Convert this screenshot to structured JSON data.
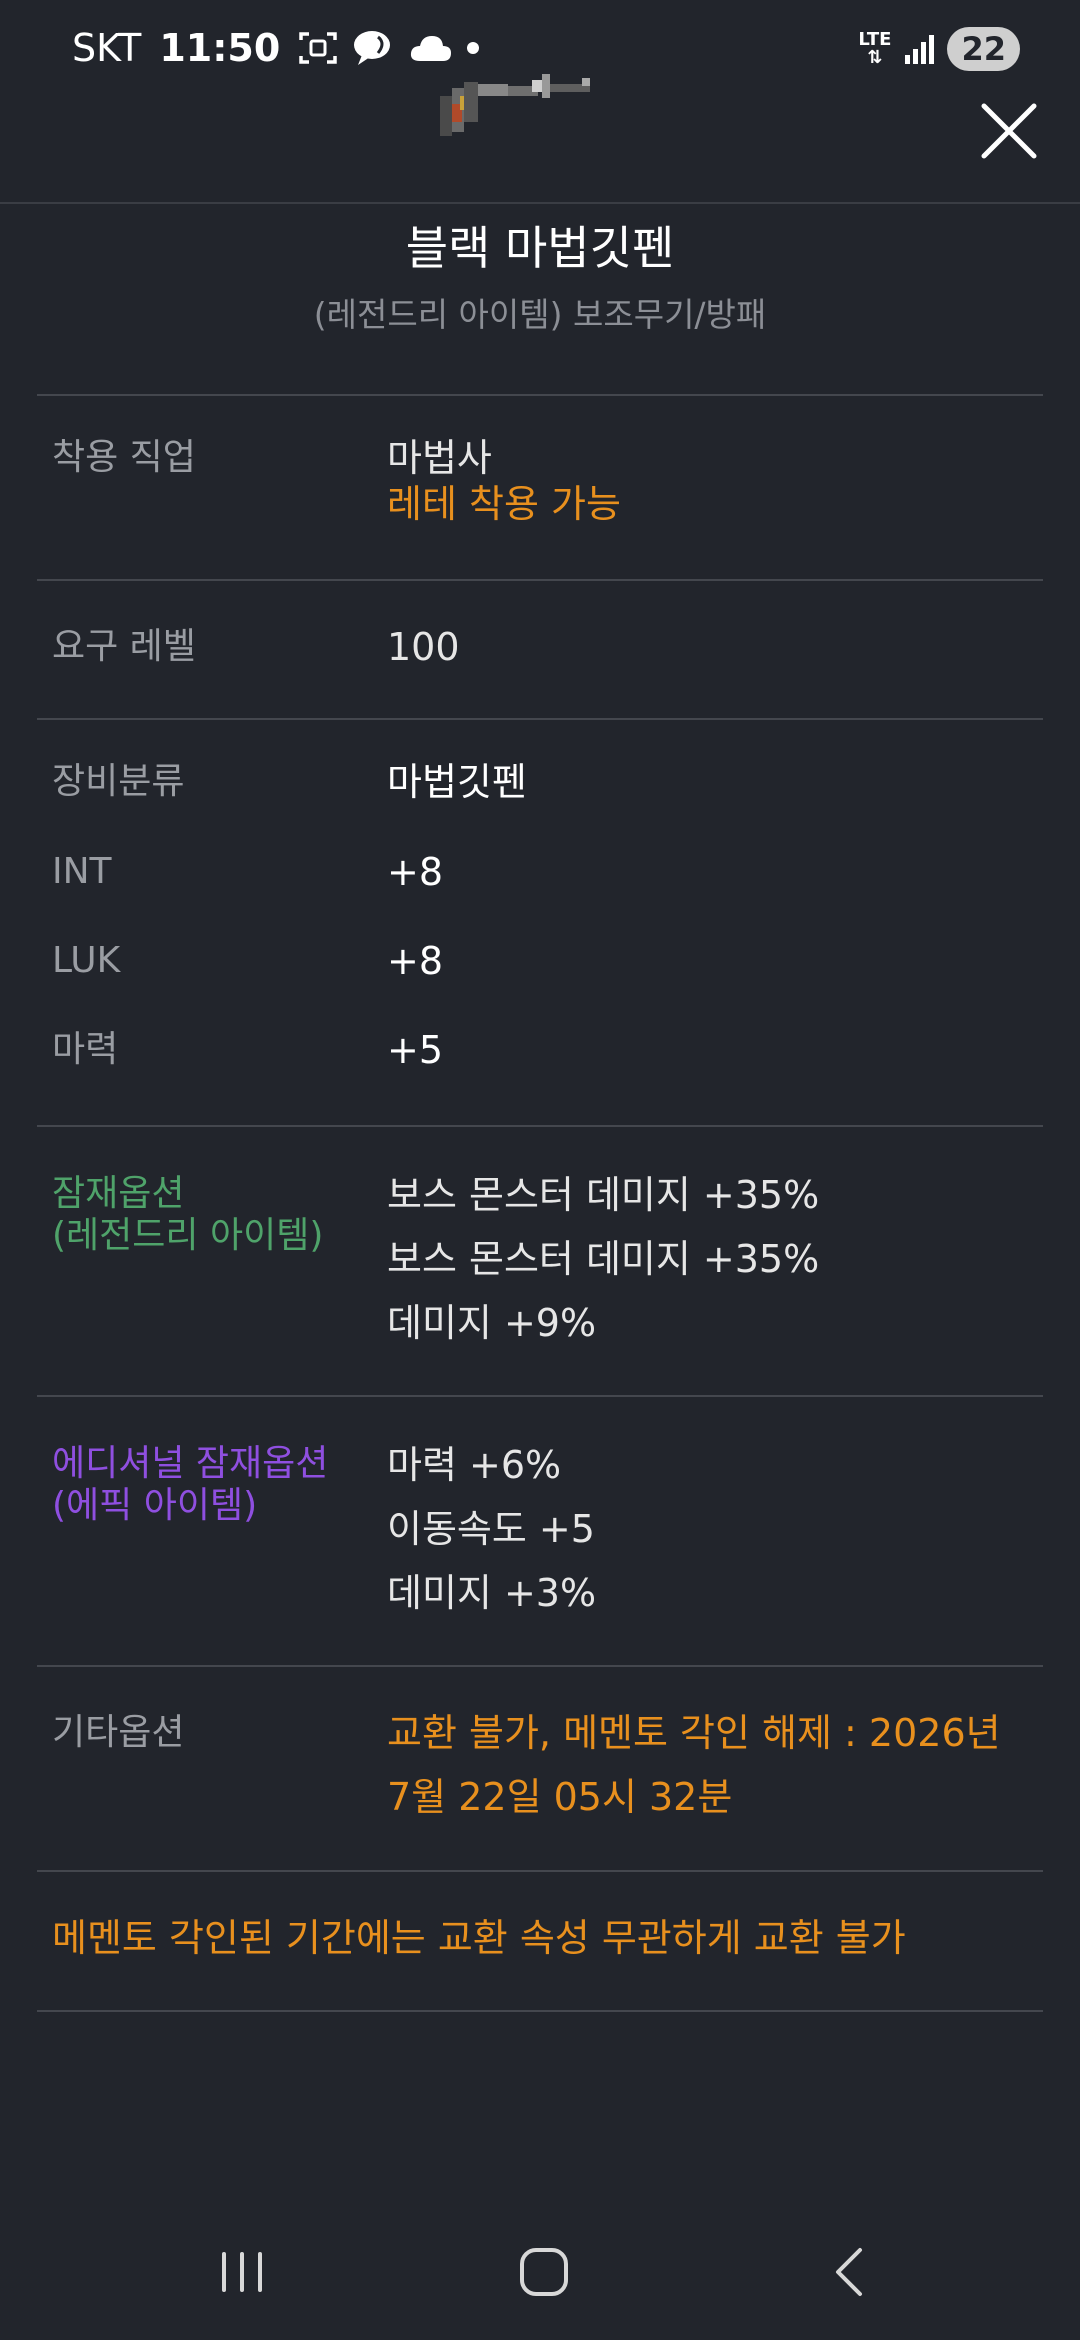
{
  "status_bar": {
    "carrier": "SKT",
    "time": "11:50",
    "network": "LTE",
    "battery": "22"
  },
  "item": {
    "name": "블랙 마법깃펜",
    "subtitle": "(레전드리 아이템) 보조무기/방패"
  },
  "job": {
    "label": "착용 직업",
    "value": "마법사",
    "note": "레테 착용 가능"
  },
  "level": {
    "label": "요구 레벨",
    "value": "100"
  },
  "equip": {
    "category_label": "장비분류",
    "category_value": "마법깃펜",
    "stats": [
      {
        "label": "INT",
        "value": "+8"
      },
      {
        "label": "LUK",
        "value": "+8"
      },
      {
        "label": "마력",
        "value": "+5"
      }
    ]
  },
  "potential": {
    "label_line1": "잠재옵션",
    "label_line2": "(레전드리 아이템)",
    "lines": [
      "보스 몬스터 데미지 +35%",
      "보스 몬스터 데미지 +35%",
      "데미지 +9%"
    ],
    "color": "#4fa36a"
  },
  "additional": {
    "label_line1": "에디셔널 잠재옵션",
    "label_line2": "(에픽 아이템)",
    "lines": [
      "마력 +6%",
      "이동속도 +5",
      "데미지 +3%"
    ],
    "color": "#8f4fe0"
  },
  "etc": {
    "label": "기타옵션",
    "line1": "교환 불가, 메멘토 각인 해제 : 2026년",
    "line2": "7월 22일 05시 32분"
  },
  "notice": "메멘토 각인된 기간에는 교환 속성 무관하게 교환 불가",
  "accent_orange": "#e8901e"
}
